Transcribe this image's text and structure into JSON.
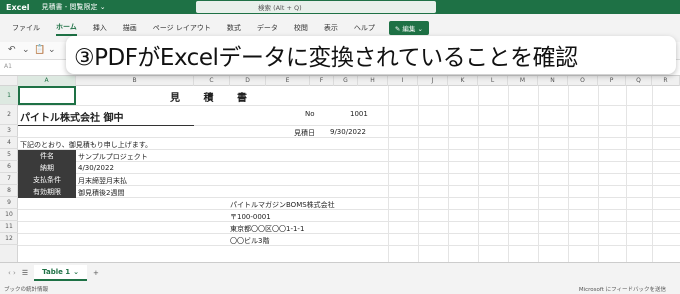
{
  "titlebar": {
    "app": "Excel",
    "doc": "見積書 - 閲覧限定 ⌄",
    "search_placeholder": "検索 (Alt + Q)"
  },
  "ribbon_tabs": [
    "ファイル",
    "ホーム",
    "挿入",
    "描画",
    "ページ レイアウト",
    "数式",
    "データ",
    "校閲",
    "表示",
    "ヘルプ"
  ],
  "edit_button": "✎ 編集 ⌄",
  "namebox": "A1",
  "overlay_caption": "③PDFがExcelデータに変換されていることを確認",
  "columns": [
    "A",
    "B",
    "C",
    "D",
    "E",
    "F",
    "G",
    "H",
    "I",
    "J",
    "K",
    "L",
    "M",
    "N",
    "O",
    "P",
    "Q",
    "R"
  ],
  "rows": [
    "1",
    "2",
    "3",
    "4",
    "5",
    "6",
    "7",
    "8",
    "9",
    "10",
    "11",
    "12"
  ],
  "sheet": {
    "title": "見 積 書",
    "company": "パイトル株式会社 御中",
    "no_label": "No",
    "no_value": "1001",
    "date_label": "見積日",
    "date_value": "9/30/2022",
    "intro": "下記のとおり、御見積もり申し上げます。",
    "fields": [
      {
        "label": "件名",
        "value": "サンプルプロジェクト"
      },
      {
        "label": "納期",
        "value": "4/30/2022"
      },
      {
        "label": "支払条件",
        "value": "月末締翌月末払"
      },
      {
        "label": "有効期限",
        "value": "御見積後2週間"
      }
    ],
    "sender": [
      "パイトルマガジンBOMS株式会社",
      "〒100-0001",
      "東京都〇〇区〇〇1-1-1",
      "〇〇ビル3階"
    ]
  },
  "sheet_tab": "Table 1",
  "status_left": "ブックの統計情報",
  "status_right": "Microsoft にフィードバックを送信"
}
